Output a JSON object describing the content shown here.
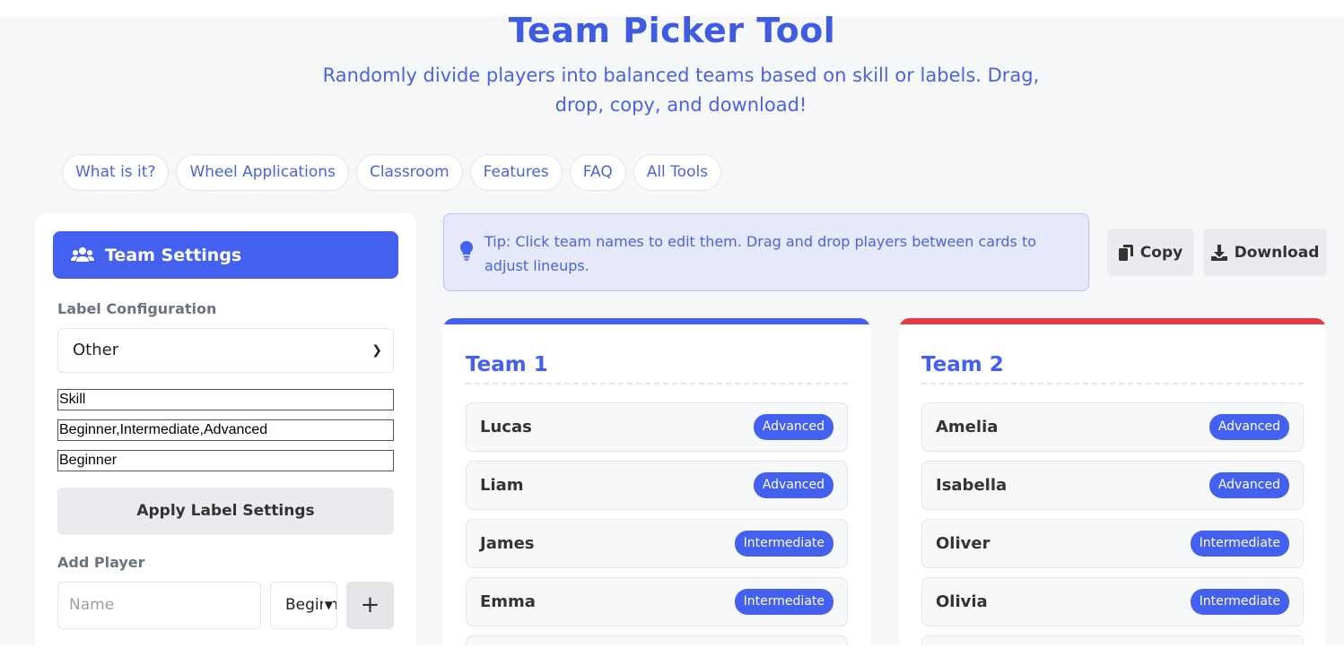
{
  "header": {
    "title": "Team Picker Tool",
    "subtitle": "Randomly divide players into balanced teams based on skill or labels. Drag, drop, copy, and download!"
  },
  "nav": [
    "What is it?",
    "Wheel Applications",
    "Classroom",
    "Features",
    "FAQ",
    "All Tools"
  ],
  "sidebar": {
    "title": "Team Settings",
    "label_config_heading": "Label Configuration",
    "label_config_value": "Other",
    "label_name": "Skill",
    "label_options": "Beginner,Intermediate,Advanced",
    "default_label": "Beginner",
    "apply_label": "Apply Label Settings",
    "add_player_heading": "Add Player",
    "name_placeholder": "Name",
    "level_value": "Beginner",
    "add_symbol": "+"
  },
  "tip": "Tip: Click team names to edit them. Drag and drop players between cards to adjust lineups.",
  "actions": {
    "copy": "Copy",
    "download": "Download"
  },
  "teams": [
    {
      "name": "Team 1",
      "accent": "#4361ee",
      "players": [
        {
          "name": "Lucas",
          "level": "Advanced"
        },
        {
          "name": "Liam",
          "level": "Advanced"
        },
        {
          "name": "James",
          "level": "Intermediate"
        },
        {
          "name": "Emma",
          "level": "Intermediate"
        }
      ]
    },
    {
      "name": "Team 2",
      "accent": "#e63946",
      "players": [
        {
          "name": "Amelia",
          "level": "Advanced"
        },
        {
          "name": "Isabella",
          "level": "Advanced"
        },
        {
          "name": "Oliver",
          "level": "Intermediate"
        },
        {
          "name": "Olivia",
          "level": "Intermediate"
        }
      ]
    }
  ],
  "colors": {
    "primary": "#4361ee",
    "team2": "#e63946"
  }
}
